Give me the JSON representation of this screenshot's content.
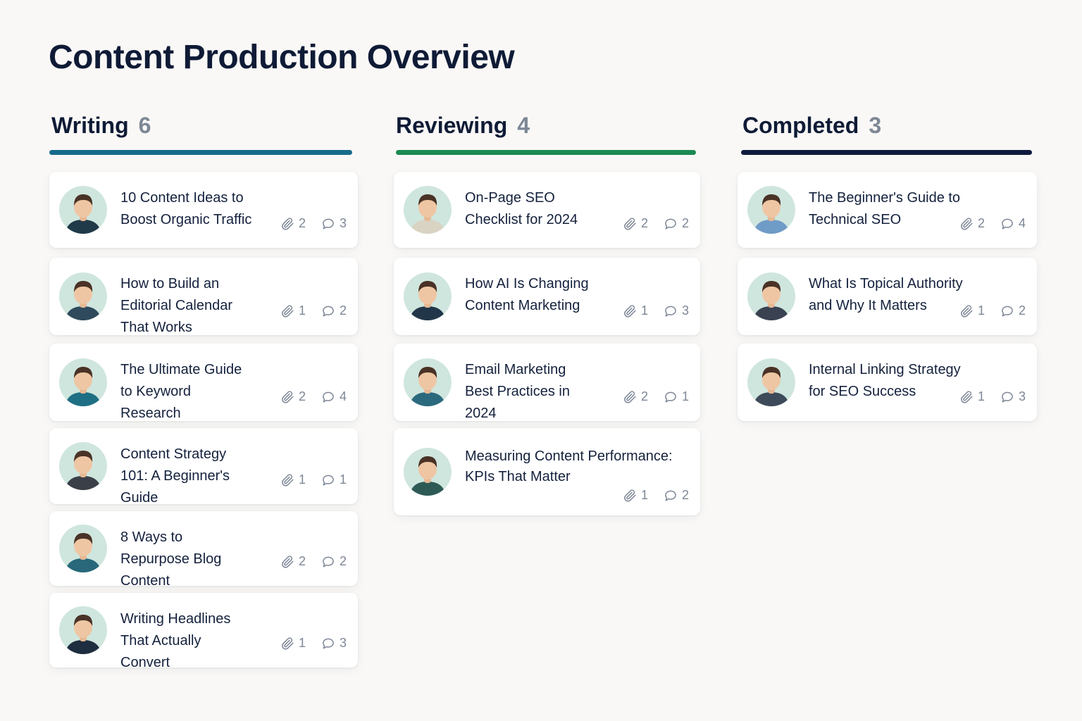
{
  "page": {
    "title": "Content Production Overview"
  },
  "colors": {
    "writing_accent": "#176c8c",
    "reviewing_accent": "#1b8a52",
    "completed_accent": "#0f1b3d"
  },
  "icons": {
    "attachment": "paperclip-icon",
    "comments": "comment-bubble-icon"
  },
  "columns": [
    {
      "title": "Writing",
      "count": "6",
      "cards": [
        {
          "title": "10 Content Ideas to Boost Organic Traffic",
          "attachments": "2",
          "comments": "3"
        },
        {
          "title": "How to Build an Editorial Calendar That Works",
          "attachments": "1",
          "comments": "2"
        },
        {
          "title": "The Ultimate Guide to Keyword Research",
          "attachments": "2",
          "comments": "4"
        },
        {
          "title": "Content Strategy 101: A Beginner's Guide",
          "attachments": "1",
          "comments": "1"
        },
        {
          "title": "8 Ways to Repurpose Blog Content",
          "attachments": "2",
          "comments": "2"
        },
        {
          "title": "Writing Headlines That Actually Convert",
          "attachments": "1",
          "comments": "3"
        }
      ]
    },
    {
      "title": "Reviewing",
      "count": "4",
      "cards": [
        {
          "title": "On-Page SEO Checklist for 2024",
          "attachments": "2",
          "comments": "2"
        },
        {
          "title": "How AI Is Changing Content Marketing",
          "attachments": "1",
          "comments": "3"
        },
        {
          "title": "Email Marketing Best Practices in 2024",
          "attachments": "2",
          "comments": "1"
        },
        {
          "title": "Measuring Content Performance: KPIs That Matter",
          "attachments": "1",
          "comments": "2"
        }
      ]
    },
    {
      "title": "Completed",
      "count": "3",
      "cards": [
        {
          "title": "The Beginner's Guide to Technical SEO",
          "attachments": "2",
          "comments": "4"
        },
        {
          "title": "What Is Topical Authority and Why It Matters",
          "attachments": "1",
          "comments": "2"
        },
        {
          "title": "Internal Linking Strategy for SEO Success",
          "attachments": "1",
          "comments": "3"
        }
      ]
    }
  ]
}
